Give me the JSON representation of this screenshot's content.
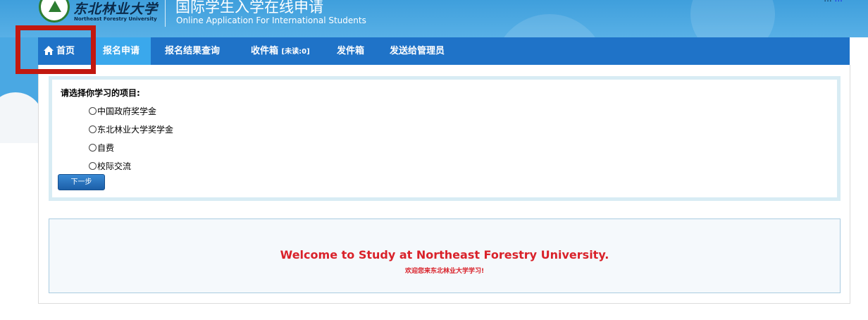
{
  "header": {
    "logo_cn": "东北林业大学",
    "logo_en": "Northeast Forestry University",
    "title_cn": "国际学生入学在线申请",
    "title_en": "Online Application For International Students",
    "top_links": [
      "...",
      "..."
    ]
  },
  "nav": {
    "items": [
      {
        "label": "首页",
        "icon": "home-icon"
      },
      {
        "label": "报名申请"
      },
      {
        "label": "报名结果查询"
      },
      {
        "label": "收件箱",
        "badge": "[未读:0]"
      },
      {
        "label": "发件箱"
      },
      {
        "label": "发送给管理员"
      }
    ],
    "active_index": 1
  },
  "form": {
    "title": "请选择你学习的项目:",
    "options": [
      "中国政府奖学金",
      "东北林业大学奖学金",
      "自费",
      "校际交流"
    ],
    "next_button": "下一步"
  },
  "welcome": {
    "en": "Welcome to Study at Northeast Forestry University.",
    "cn": "欢迎您来东北林业大学学习!"
  },
  "colors": {
    "nav_bg": "#1f73c8",
    "nav_active": "#3aa8ec",
    "header_bg": "#4aa8e3",
    "highlight": "#c2180f",
    "welcome_text": "#d9222a"
  }
}
